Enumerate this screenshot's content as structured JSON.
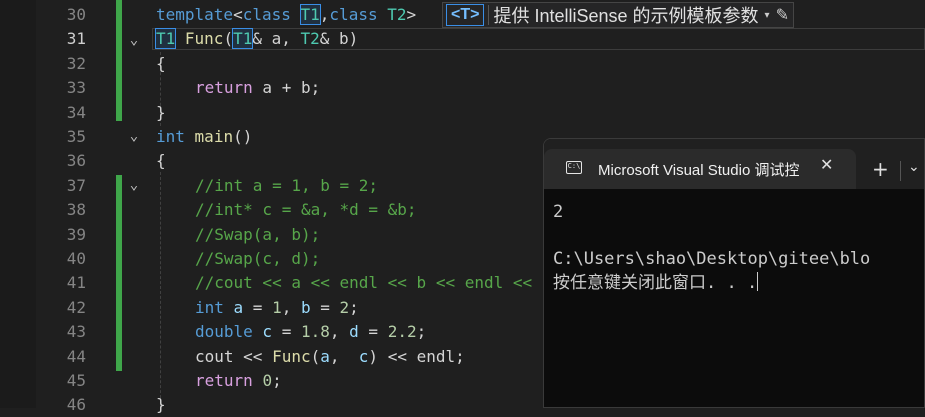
{
  "editor": {
    "lines": [
      {
        "n": "30"
      },
      {
        "n": "31"
      },
      {
        "n": "32"
      },
      {
        "n": "33"
      },
      {
        "n": "34"
      },
      {
        "n": "35"
      },
      {
        "n": "36"
      },
      {
        "n": "37"
      },
      {
        "n": "38"
      },
      {
        "n": "39"
      },
      {
        "n": "40"
      },
      {
        "n": "41"
      },
      {
        "n": "42"
      },
      {
        "n": "43"
      },
      {
        "n": "44"
      },
      {
        "n": "45"
      },
      {
        "n": "46"
      }
    ],
    "code": {
      "l30_kw1": "template",
      "l30_p1": "<",
      "l30_kw2": "class",
      "l30_t1": "T1",
      "l30_p2": ",",
      "l30_kw3": "class",
      "l30_t2": "T2",
      "l30_p3": ">",
      "l31_t1": "T1",
      "l31_fn": "Func",
      "l31_p1": "(",
      "l31_t2": "T1",
      "l31_p2": "& a, ",
      "l31_t3": "T2",
      "l31_p3": "& b)",
      "l32": "{",
      "l33_kw": "return",
      "l33_rest": " a + b;",
      "l34": "}",
      "l35_kw": "int",
      "l35_fn": "main",
      "l35_p": "()",
      "l36": "{",
      "l37": "//int a = 1, b = 2;",
      "l38": "//int* c = &a, *d = &b;",
      "l39": "//Swap(a, b);",
      "l40": "//Swap(c, d);",
      "l41": "//cout << a << endl << b << endl <<",
      "l42_kw": "int",
      "l42_v1": " a",
      "l42_p1": " = ",
      "l42_n1": "1",
      "l42_p2": ", ",
      "l42_v2": "b",
      "l42_p3": " = ",
      "l42_n2": "2",
      "l42_p4": ";",
      "l43_kw": "double",
      "l43_v1": " c",
      "l43_p1": " = ",
      "l43_n1": "1.8",
      "l43_p2": ", ",
      "l43_v2": "d",
      "l43_p3": " = ",
      "l43_n2": "2.2",
      "l43_p4": ";",
      "l44_a": "cout << ",
      "l44_fn": "Func",
      "l44_b": "(",
      "l44_v1": "a",
      "l44_c": ",  ",
      "l44_v2": "c",
      "l44_d": ") << endl;",
      "l45_kw": "return",
      "l45_p": " ",
      "l45_n": "0",
      "l45_e": ";",
      "l46": "}"
    },
    "fold_glyph": "⌄"
  },
  "intellisense": {
    "badge": "<T>",
    "text": "提供 IntelliSense 的示例模板参数",
    "dropdown": "▾",
    "edit": "✎"
  },
  "console": {
    "title": "Microsoft Visual Studio 调试控",
    "icon_text": "C:\\",
    "close": "✕",
    "plus": "+",
    "chevron": "⌄",
    "output_line1": "2",
    "output_line2": "",
    "output_line3": "C:\\Users\\shao\\Desktop\\gitee\\blo",
    "output_line4": "按任意键关闭此窗口. . ."
  }
}
